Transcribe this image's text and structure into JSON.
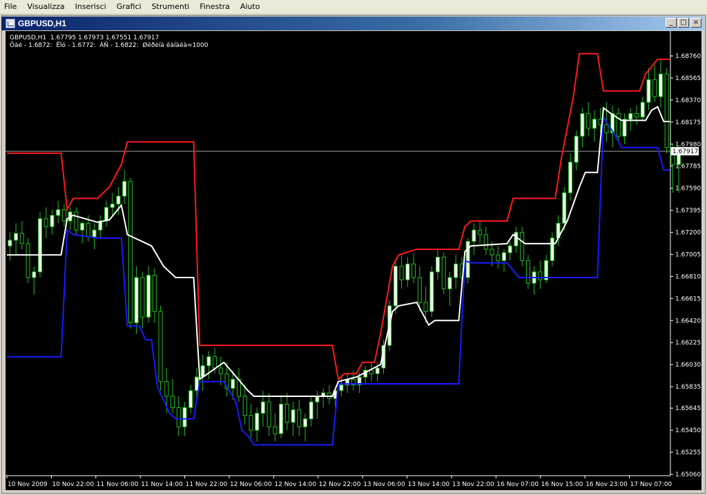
{
  "menu": [
    "File",
    "Visualizza",
    "Inserisci",
    "Grafici",
    "Strumenti",
    "Finestra",
    "Aiuto"
  ],
  "window": {
    "title": "GBPUSD,H1",
    "buttons": [
      "_",
      "□",
      "×"
    ]
  },
  "chart_header": {
    "line1": "GBPUSD,H1  1.67795 1.67973 1.67551 1.67917",
    "line2": "Õàé - 1.6872:  Ëîó - 1.6772:  ÀÑ - 1.6822:  Øèðèíà êàíàëà=1000"
  },
  "chart_data": {
    "type": "line",
    "x_ticks": [
      "10 Nov 2009",
      "10 Nov 22:00",
      "11 Nov 06:00",
      "11 Nov 14:00",
      "11 Nov 22:00",
      "12 Nov 06:00",
      "12 Nov 14:00",
      "12 Nov 22:00",
      "13 Nov 06:00",
      "13 Nov 14:00",
      "13 Nov 22:00",
      "16 Nov 07:00",
      "16 Nov 15:00",
      "16 Nov 23:00",
      "17 Nov 07:00"
    ],
    "y_ticks": [
      "1.68760",
      "1.68565",
      "1.68370",
      "1.68175",
      "1.67980",
      "1.67785",
      "1.67590",
      "1.67395",
      "1.67200",
      "1.67005",
      "1.66810",
      "1.66615",
      "1.66420",
      "1.66225",
      "1.66030",
      "1.65835",
      "1.65645",
      "1.65450",
      "1.65255",
      "1.65060"
    ],
    "y_range": [
      1.6506,
      1.6876
    ],
    "current_price": "1.67917",
    "colors": {
      "upper": "#ff1a1a",
      "lower": "#1a1aff",
      "middle": "#ffffff",
      "candle_up": "#f4fff0",
      "candle_down": "#20c020",
      "price_line": "#a0a0a0"
    },
    "channels": {
      "upper": [
        [
          0,
          1.679
        ],
        [
          9,
          1.679
        ],
        [
          10,
          1.674
        ],
        [
          11,
          1.675
        ],
        [
          15,
          1.675
        ],
        [
          17,
          1.676
        ],
        [
          19,
          1.678
        ],
        [
          20,
          1.68
        ],
        [
          31,
          1.68
        ],
        [
          32,
          1.662
        ],
        [
          54,
          1.662
        ],
        [
          55,
          1.659
        ],
        [
          56,
          1.6595
        ],
        [
          58,
          1.6595
        ],
        [
          59,
          1.6605
        ],
        [
          61,
          1.6605
        ],
        [
          62,
          1.663
        ],
        [
          64,
          1.669
        ],
        [
          65,
          1.67
        ],
        [
          68,
          1.6705
        ],
        [
          75,
          1.6705
        ],
        [
          76,
          1.6725
        ],
        [
          77,
          1.673
        ],
        [
          83,
          1.673
        ],
        [
          84,
          1.675
        ],
        [
          91,
          1.675
        ],
        [
          92,
          1.6785
        ],
        [
          94,
          1.684
        ],
        [
          95,
          1.6878
        ],
        [
          98,
          1.6878
        ],
        [
          99,
          1.6845
        ],
        [
          105,
          1.6845
        ],
        [
          106,
          1.686
        ],
        [
          108,
          1.6873
        ],
        [
          110,
          1.6873
        ]
      ],
      "middle": [
        [
          0,
          1.67
        ],
        [
          9,
          1.67
        ],
        [
          10,
          1.6732
        ],
        [
          11,
          1.6735
        ],
        [
          15,
          1.6729
        ],
        [
          17,
          1.6731
        ],
        [
          19,
          1.6744
        ],
        [
          20,
          1.6718
        ],
        [
          24,
          1.6708
        ],
        [
          26,
          1.669
        ],
        [
          28,
          1.668
        ],
        [
          31,
          1.668
        ],
        [
          32,
          1.659
        ],
        [
          36,
          1.6605
        ],
        [
          40,
          1.658
        ],
        [
          41,
          1.6575
        ],
        [
          54,
          1.6575
        ],
        [
          55,
          1.6588
        ],
        [
          58,
          1.6592
        ],
        [
          62,
          1.6603
        ],
        [
          64,
          1.665
        ],
        [
          65,
          1.6655
        ],
        [
          68,
          1.6658
        ],
        [
          70,
          1.6638
        ],
        [
          71,
          1.6642
        ],
        [
          75,
          1.6642
        ],
        [
          76,
          1.6703
        ],
        [
          77,
          1.6708
        ],
        [
          83,
          1.671
        ],
        [
          84,
          1.6718
        ],
        [
          86,
          1.671
        ],
        [
          91,
          1.671
        ],
        [
          93,
          1.673
        ],
        [
          95,
          1.676
        ],
        [
          96,
          1.6773
        ],
        [
          98,
          1.6773
        ],
        [
          99,
          1.683
        ],
        [
          100,
          1.6826
        ],
        [
          102,
          1.6819
        ],
        [
          106,
          1.6819
        ],
        [
          107,
          1.6828
        ],
        [
          108,
          1.6831
        ],
        [
          109,
          1.6818
        ],
        [
          110,
          1.6818
        ]
      ],
      "lower": [
        [
          0,
          1.661
        ],
        [
          9,
          1.661
        ],
        [
          10,
          1.6722
        ],
        [
          11,
          1.6718
        ],
        [
          15,
          1.6715
        ],
        [
          19,
          1.6715
        ],
        [
          20,
          1.6637
        ],
        [
          22,
          1.6637
        ],
        [
          23,
          1.6625
        ],
        [
          24,
          1.6625
        ],
        [
          25,
          1.6583
        ],
        [
          27,
          1.656
        ],
        [
          28,
          1.6555
        ],
        [
          31,
          1.6555
        ],
        [
          32,
          1.6588
        ],
        [
          36,
          1.6588
        ],
        [
          38,
          1.657
        ],
        [
          39,
          1.6545
        ],
        [
          40,
          1.654
        ],
        [
          41,
          1.6532
        ],
        [
          54,
          1.6532
        ],
        [
          55,
          1.6586
        ],
        [
          75,
          1.6586
        ],
        [
          76,
          1.6695
        ],
        [
          77,
          1.6693
        ],
        [
          83,
          1.6693
        ],
        [
          85,
          1.668
        ],
        [
          98,
          1.668
        ],
        [
          99,
          1.6822
        ],
        [
          101,
          1.6805
        ],
        [
          102,
          1.6795
        ],
        [
          108,
          1.6795
        ],
        [
          109,
          1.6775
        ],
        [
          110,
          1.6775
        ]
      ]
    },
    "candles": [
      [
        1.6708,
        1.672,
        1.6695,
        1.6713
      ],
      [
        1.6713,
        1.6728,
        1.67,
        1.6719
      ],
      [
        1.6719,
        1.673,
        1.6705,
        1.671
      ],
      [
        1.671,
        1.6715,
        1.6675,
        1.668
      ],
      [
        1.668,
        1.669,
        1.6665,
        1.6685
      ],
      [
        1.6685,
        1.6738,
        1.668,
        1.6732
      ],
      [
        1.6732,
        1.6742,
        1.6715,
        1.6725
      ],
      [
        1.6725,
        1.674,
        1.6718,
        1.6735
      ],
      [
        1.6735,
        1.6748,
        1.6728,
        1.674
      ],
      [
        1.674,
        1.6745,
        1.6725,
        1.673
      ],
      [
        1.673,
        1.6742,
        1.6722,
        1.6738
      ],
      [
        1.6738,
        1.6742,
        1.6718,
        1.6722
      ],
      [
        1.6722,
        1.673,
        1.671,
        1.6728
      ],
      [
        1.6728,
        1.6735,
        1.6712,
        1.6716
      ],
      [
        1.6716,
        1.6728,
        1.6705,
        1.6722
      ],
      [
        1.6722,
        1.6735,
        1.6715,
        1.673
      ],
      [
        1.673,
        1.6748,
        1.6725,
        1.6742
      ],
      [
        1.6742,
        1.6755,
        1.6735,
        1.6745
      ],
      [
        1.6745,
        1.676,
        1.6735,
        1.6752
      ],
      [
        1.6752,
        1.6775,
        1.6745,
        1.6765
      ],
      [
        1.6765,
        1.6768,
        1.6635,
        1.664
      ],
      [
        1.664,
        1.669,
        1.663,
        1.668
      ],
      [
        1.668,
        1.6685,
        1.6635,
        1.6645
      ],
      [
        1.6645,
        1.669,
        1.664,
        1.6682
      ],
      [
        1.6682,
        1.6688,
        1.664,
        1.665
      ],
      [
        1.665,
        1.6655,
        1.658,
        1.6588
      ],
      [
        1.6588,
        1.66,
        1.656,
        1.6575
      ],
      [
        1.6575,
        1.659,
        1.656,
        1.6565
      ],
      [
        1.6565,
        1.6575,
        1.654,
        1.6548
      ],
      [
        1.6548,
        1.657,
        1.654,
        1.6565
      ],
      [
        1.6565,
        1.6585,
        1.656,
        1.658
      ],
      [
        1.658,
        1.66,
        1.657,
        1.6592
      ],
      [
        1.6592,
        1.6612,
        1.658,
        1.6602
      ],
      [
        1.6602,
        1.6615,
        1.659,
        1.661
      ],
      [
        1.661,
        1.6618,
        1.6595,
        1.66
      ],
      [
        1.66,
        1.661,
        1.6585,
        1.6595
      ],
      [
        1.6595,
        1.6605,
        1.6575,
        1.6582
      ],
      [
        1.6582,
        1.6598,
        1.6572,
        1.659
      ],
      [
        1.659,
        1.66,
        1.657,
        1.6575
      ],
      [
        1.6575,
        1.6585,
        1.655,
        1.6558
      ],
      [
        1.6558,
        1.6568,
        1.6538,
        1.6545
      ],
      [
        1.6545,
        1.6565,
        1.6535,
        1.656
      ],
      [
        1.656,
        1.658,
        1.6548,
        1.657
      ],
      [
        1.657,
        1.6578,
        1.654,
        1.6548
      ],
      [
        1.6548,
        1.656,
        1.6535,
        1.6542
      ],
      [
        1.6542,
        1.6575,
        1.6538,
        1.6568
      ],
      [
        1.6568,
        1.6578,
        1.6545,
        1.6552
      ],
      [
        1.6552,
        1.657,
        1.654,
        1.6563
      ],
      [
        1.6563,
        1.6572,
        1.654,
        1.6548
      ],
      [
        1.6548,
        1.656,
        1.6535,
        1.6555
      ],
      [
        1.6555,
        1.6575,
        1.6548,
        1.657
      ],
      [
        1.657,
        1.658,
        1.6555,
        1.6575
      ],
      [
        1.6575,
        1.6582,
        1.6565,
        1.6578
      ],
      [
        1.6578,
        1.6585,
        1.6568,
        1.6573
      ],
      [
        1.6573,
        1.6582,
        1.6565,
        1.658
      ],
      [
        1.658,
        1.6592,
        1.6575,
        1.6585
      ],
      [
        1.6585,
        1.6595,
        1.6578,
        1.659
      ],
      [
        1.659,
        1.6598,
        1.658,
        1.6585
      ],
      [
        1.6585,
        1.6596,
        1.6578,
        1.6592
      ],
      [
        1.6592,
        1.6602,
        1.6585,
        1.6598
      ],
      [
        1.6598,
        1.6605,
        1.6588,
        1.6595
      ],
      [
        1.6595,
        1.6605,
        1.6588,
        1.66
      ],
      [
        1.66,
        1.6625,
        1.6595,
        1.662
      ],
      [
        1.662,
        1.666,
        1.6615,
        1.6655
      ],
      [
        1.6655,
        1.6695,
        1.6648,
        1.669
      ],
      [
        1.669,
        1.67,
        1.667,
        1.6678
      ],
      [
        1.6678,
        1.6698,
        1.6672,
        1.6692
      ],
      [
        1.6692,
        1.6702,
        1.6675,
        1.668
      ],
      [
        1.668,
        1.669,
        1.665,
        1.6658
      ],
      [
        1.6658,
        1.6672,
        1.664,
        1.665
      ],
      [
        1.665,
        1.669,
        1.6645,
        1.6685
      ],
      [
        1.6685,
        1.6705,
        1.6678,
        1.6698
      ],
      [
        1.6698,
        1.6702,
        1.6665,
        1.667
      ],
      [
        1.667,
        1.6685,
        1.6655,
        1.668
      ],
      [
        1.668,
        1.67,
        1.667,
        1.6692
      ],
      [
        1.6692,
        1.6698,
        1.6672,
        1.668
      ],
      [
        1.668,
        1.6715,
        1.6675,
        1.6712
      ],
      [
        1.6712,
        1.6728,
        1.67,
        1.6722
      ],
      [
        1.6722,
        1.673,
        1.671,
        1.6718
      ],
      [
        1.6718,
        1.6725,
        1.67,
        1.6705
      ],
      [
        1.6705,
        1.6712,
        1.669,
        1.67
      ],
      [
        1.67,
        1.6708,
        1.6688,
        1.6695
      ],
      [
        1.6695,
        1.6705,
        1.6685,
        1.6702
      ],
      [
        1.6702,
        1.6712,
        1.6695,
        1.6708
      ],
      [
        1.6708,
        1.6725,
        1.6702,
        1.672
      ],
      [
        1.672,
        1.6725,
        1.669,
        1.6695
      ],
      [
        1.6695,
        1.67,
        1.667,
        1.6675
      ],
      [
        1.6675,
        1.669,
        1.6665,
        1.6685
      ],
      [
        1.6685,
        1.6695,
        1.667,
        1.6678
      ],
      [
        1.6678,
        1.67,
        1.6675,
        1.6695
      ],
      [
        1.6695,
        1.672,
        1.669,
        1.6715
      ],
      [
        1.6715,
        1.6735,
        1.6708,
        1.6728
      ],
      [
        1.6728,
        1.676,
        1.6722,
        1.6755
      ],
      [
        1.6755,
        1.679,
        1.6748,
        1.6782
      ],
      [
        1.6782,
        1.681,
        1.6775,
        1.6805
      ],
      [
        1.6805,
        1.683,
        1.6795,
        1.6825
      ],
      [
        1.6825,
        1.6835,
        1.6805,
        1.6812
      ],
      [
        1.6812,
        1.6828,
        1.68,
        1.682
      ],
      [
        1.682,
        1.683,
        1.6808,
        1.6815
      ],
      [
        1.6815,
        1.6835,
        1.68,
        1.6808
      ],
      [
        1.6808,
        1.6832,
        1.6795,
        1.6825
      ],
      [
        1.6825,
        1.683,
        1.68,
        1.6805
      ],
      [
        1.6805,
        1.6825,
        1.6798,
        1.682
      ],
      [
        1.682,
        1.683,
        1.681,
        1.6825
      ],
      [
        1.6825,
        1.6832,
        1.6815,
        1.6822
      ],
      [
        1.6822,
        1.684,
        1.6818,
        1.6835
      ],
      [
        1.6835,
        1.6865,
        1.6828,
        1.6855
      ],
      [
        1.6855,
        1.6868,
        1.6835,
        1.684
      ],
      [
        1.684,
        1.6872,
        1.683,
        1.686
      ],
      [
        1.686,
        1.6865,
        1.679,
        1.6795
      ],
      [
        1.6795,
        1.6798,
        1.6755,
        1.678
      ],
      [
        1.678,
        1.6797,
        1.6755,
        1.6792
      ]
    ]
  }
}
